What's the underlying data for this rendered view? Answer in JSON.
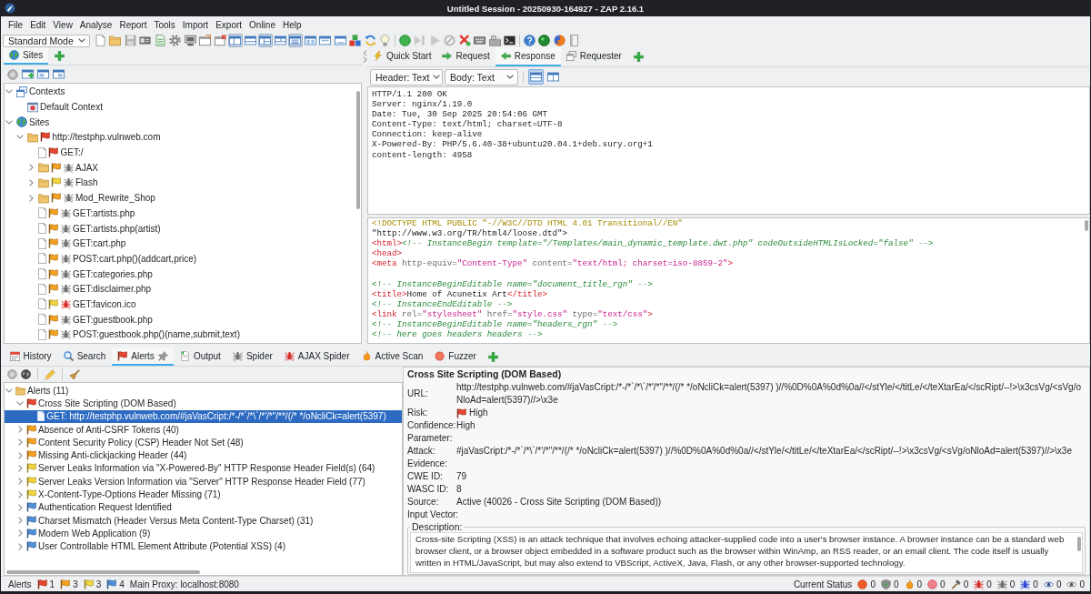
{
  "window": {
    "title": "Untitled Session - 20250930-164927 - ZAP 2.16.1"
  },
  "menu": [
    "File",
    "Edit",
    "View",
    "Analyse",
    "Report",
    "Tools",
    "Import",
    "Export",
    "Online",
    "Help"
  ],
  "toolbar": {
    "mode": "Standard Mode",
    "layout_toggles": [
      {
        "pressed": true
      },
      {
        "pressed": false
      },
      {
        "pressed": true
      },
      {
        "pressed": false
      },
      {
        "pressed": true
      },
      {
        "pressed": false
      },
      {
        "pressed": false
      },
      {
        "pressed": false
      }
    ]
  },
  "sites_panel": {
    "tabs": [
      {
        "label": "Sites",
        "selected": true
      }
    ],
    "tree": [
      {
        "label": "Contexts",
        "kind": "contexts",
        "expanded": true,
        "children": [
          {
            "label": "Default Context",
            "kind": "context"
          }
        ]
      },
      {
        "label": "Sites",
        "kind": "sites",
        "expanded": true,
        "children": [
          {
            "label": "http://testphp.vulnweb.com",
            "kind": "folder",
            "flag": {
              "color": "#e9462f"
            },
            "expanded": true,
            "children": [
              {
                "label": "GET:/",
                "kind": "page",
                "flag": {
                  "color": "#e9462f"
                }
              },
              {
                "label": "AJAX",
                "kind": "folder",
                "flag": {
                  "color": "#f6a21f"
                },
                "spider": {
                  "color": "#6f6f6f"
                },
                "expanded": false
              },
              {
                "label": "Flash",
                "kind": "folder",
                "flag": {
                  "color": "#f3d43a"
                },
                "spider": {
                  "color": "#6f6f6f"
                },
                "expanded": false
              },
              {
                "label": "Mod_Rewrite_Shop",
                "kind": "folder",
                "flag": {
                  "color": "#f6a21f"
                },
                "spider": {
                  "color": "#6f6f6f"
                },
                "expanded": false
              },
              {
                "label": "GET:artists.php",
                "kind": "page",
                "flag": {
                  "color": "#f6a21f"
                },
                "spider": {
                  "color": "#6f6f6f"
                }
              },
              {
                "label": "GET:artists.php(artist)",
                "kind": "page",
                "flag": {
                  "color": "#f6a21f"
                },
                "spider": {
                  "color": "#6f6f6f"
                }
              },
              {
                "label": "GET:cart.php",
                "kind": "page",
                "flag": {
                  "color": "#f6a21f"
                },
                "spider": {
                  "color": "#6f6f6f"
                }
              },
              {
                "label": "POST:cart.php()(addcart,price)",
                "kind": "page",
                "flag": {
                  "color": "#f6a21f"
                },
                "spider": {
                  "color": "#6f6f6f"
                }
              },
              {
                "label": "GET:categories.php",
                "kind": "page",
                "flag": {
                  "color": "#f6a21f"
                },
                "spider": {
                  "color": "#6f6f6f"
                }
              },
              {
                "label": "GET:disclaimer.php",
                "kind": "page",
                "flag": {
                  "color": "#f6a21f"
                },
                "spider": {
                  "color": "#6f6f6f"
                }
              },
              {
                "label": "GET:favicon.ico",
                "kind": "page",
                "flag": {
                  "color": "#f3d43a"
                },
                "spider": {
                  "color": "#d62a2a"
                }
              },
              {
                "label": "GET:guestbook.php",
                "kind": "page",
                "flag": {
                  "color": "#f6a21f"
                },
                "spider": {
                  "color": "#6f6f6f"
                }
              },
              {
                "label": "POST:guestbook.php()(name,submit,text)",
                "kind": "page",
                "flag": {
                  "color": "#f6a21f"
                },
                "spider": {
                  "color": "#6f6f6f"
                }
              }
            ]
          }
        ]
      }
    ]
  },
  "request_panel": {
    "tabs": [
      {
        "label": "Quick Start",
        "selected": false
      },
      {
        "label": "Request",
        "selected": false
      },
      {
        "label": "Response",
        "selected": true
      },
      {
        "label": "Requester",
        "selected": false
      }
    ],
    "header_view": "Header: Text",
    "body_view": "Body: Text",
    "layout_toggles": [
      {
        "pressed": true
      },
      {
        "pressed": false
      }
    ],
    "header_lines": [
      "HTTP/1.1 200 OK",
      "Server: nginx/1.19.0",
      "Date: Tue, 30 Sep 2025 20:54:06 GMT",
      "Content-Type: text/html; charset=UTF-8",
      "Connection: keep-alive",
      "X-Powered-By: PHP/5.6.40-38+ubuntu20.04.1+deb.sury.org+1",
      "content-length: 4958"
    ],
    "body_blocks": [
      {
        "lines": [
          {
            "tokens": [
              {
                "kind": "doctype",
                "text": "<!DOCTYPE HTML PUBLIC \"-//W3C//DTD HTML 4.01 Transitional//EN\""
              }
            ]
          },
          {
            "tokens": [
              {
                "kind": "text",
                "text": "\"http://www.w3.org/TR/html4/loose.dtd\">"
              }
            ]
          },
          {
            "tokens": [
              {
                "kind": "tag",
                "text": "<html>"
              },
              {
                "kind": "comment",
                "text": "<!-- InstanceBegin template=\"/Templates/main_dynamic_template.dwt.php\" codeOutsideHTMLIsLocked=\"false\" -->"
              }
            ]
          },
          {
            "tokens": [
              {
                "kind": "tag",
                "text": "<head>"
              }
            ]
          },
          {
            "tokens": [
              {
                "kind": "tag",
                "text": "<meta"
              },
              {
                "kind": "attr",
                "text": " http-equiv="
              },
              {
                "kind": "value",
                "text": "\"Content-Type\""
              },
              {
                "kind": "attr",
                "text": " content="
              },
              {
                "kind": "value",
                "text": "\"text/html; charset=iso-8859-2\""
              },
              {
                "kind": "tag",
                "text": ">"
              }
            ]
          }
        ]
      },
      {
        "lines": [
          {
            "tokens": [
              {
                "kind": "comment",
                "text": "<!-- InstanceBeginEditable name=\"document_title_rgn\" -->"
              }
            ]
          },
          {
            "tokens": [
              {
                "kind": "tag",
                "text": "<title>"
              },
              {
                "kind": "text",
                "text": "Home of Acunetix Art"
              },
              {
                "kind": "tag",
                "text": "</title>"
              }
            ]
          },
          {
            "tokens": [
              {
                "kind": "comment",
                "text": "<!-- InstanceEndEditable -->"
              }
            ]
          },
          {
            "tokens": [
              {
                "kind": "tag",
                "text": "<link"
              },
              {
                "kind": "attr",
                "text": " rel="
              },
              {
                "kind": "value",
                "text": "\"stylesheet\""
              },
              {
                "kind": "attr",
                "text": " href="
              },
              {
                "kind": "value",
                "text": "\"style.css\""
              },
              {
                "kind": "attr",
                "text": " type="
              },
              {
                "kind": "value",
                "text": "\"text/css\""
              },
              {
                "kind": "tag",
                "text": ">"
              }
            ]
          },
          {
            "tokens": [
              {
                "kind": "comment",
                "text": "<!-- InstanceBeginEditable name=\"headers_rgn\" -->"
              }
            ]
          },
          {
            "tokens": [
              {
                "kind": "comment",
                "text": "<!-- here goes headers headers -->"
              }
            ]
          }
        ]
      }
    ]
  },
  "bottom_panel": {
    "tabs": [
      {
        "label": "History",
        "selected": false,
        "pinned": false
      },
      {
        "label": "Search",
        "selected": false,
        "pinned": false
      },
      {
        "label": "Alerts",
        "selected": true,
        "pinned": true
      },
      {
        "label": "Output",
        "selected": false,
        "pinned": false
      },
      {
        "label": "Spider",
        "selected": false,
        "pinned": false
      },
      {
        "label": "AJAX Spider",
        "selected": false,
        "pinned": false
      },
      {
        "label": "Active Scan",
        "selected": false,
        "pinned": false
      },
      {
        "label": "Fuzzer",
        "selected": false,
        "pinned": false
      }
    ],
    "alerts_tree": [
      {
        "label": "Alerts (11)",
        "kind": "folder",
        "expanded": true,
        "selected": false,
        "children": [
          {
            "label": "Cross Site Scripting (DOM Based)",
            "flag": {
              "color": "#e9462f"
            },
            "expanded": true,
            "selected": false,
            "children": [
              {
                "label": "GET: http://testphp.vulnweb.com/#jaVasCript:/*-/*`/*\\`/*'/*\"/**/(/* */oNcliCk=alert(5397)",
                "kind": "page",
                "selected": true
              }
            ]
          },
          {
            "label": "Absence of Anti-CSRF Tokens (40)",
            "flag": {
              "color": "#f6a21f"
            },
            "expanded": false,
            "selected": false
          },
          {
            "label": "Content Security Policy (CSP) Header Not Set (48)",
            "flag": {
              "color": "#f6a21f"
            },
            "expanded": false,
            "selected": false
          },
          {
            "label": "Missing Anti-clickjacking Header (44)",
            "flag": {
              "color": "#f6a21f"
            },
            "expanded": false,
            "selected": false
          },
          {
            "label": "Server Leaks Information via \"X-Powered-By\" HTTP Response Header Field(s) (64)",
            "flag": {
              "color": "#f3d43a"
            },
            "expanded": false,
            "selected": false
          },
          {
            "label": "Server Leaks Version Information via \"Server\" HTTP Response Header Field (77)",
            "flag": {
              "color": "#f3d43a"
            },
            "expanded": false,
            "selected": false
          },
          {
            "label": "X-Content-Type-Options Header Missing (71)",
            "flag": {
              "color": "#f3d43a"
            },
            "expanded": false,
            "selected": false
          },
          {
            "label": "Authentication Request Identified",
            "flag": {
              "color": "#4f90dc"
            },
            "expanded": false,
            "selected": false
          },
          {
            "label": "Charset Mismatch (Header Versus Meta Content-Type Charset) (31)",
            "flag": {
              "color": "#4f90dc"
            },
            "expanded": false,
            "selected": false
          },
          {
            "label": "Modern Web Application (9)",
            "flag": {
              "color": "#4f90dc"
            },
            "expanded": false,
            "selected": false
          },
          {
            "label": "User Controllable HTML Element Attribute (Potential XSS) (4)",
            "flag": {
              "color": "#4f90dc"
            },
            "expanded": false,
            "selected": false
          }
        ]
      }
    ],
    "alert_detail": {
      "title": "Cross Site Scripting (DOM Based)",
      "fields": [
        {
          "label": "URL:",
          "value": "http://testphp.vulnweb.com/#jaVasCript:/*-/*`/*\\`/*'/*\"/**/(/* */oNcliCk=alert(5397) )//%0D%0A%0d%0a//</stYle/</titLe/</teXtarEa/</scRipt/--!>\\x3csVg/<sVg/oNloAd=alert(5397)//>\\x3e"
        },
        {
          "label": "Risk:",
          "value": "High",
          "flag": {
            "color": "#e9462f"
          }
        },
        {
          "label": "Confidence:",
          "value": "High"
        },
        {
          "label": "Parameter:"
        },
        {
          "label": "Attack:",
          "value": "#jaVasCript:/*-/*`/*\\`/*'/*\"/**/(/* */oNcliCk=alert(5397) )//%0D%0A%0d%0a//</stYle/</titLe/</teXtarEa/</scRipt/--!>\\x3csVg/<sVg/oNloAd=alert(5397)//>\\x3e"
        },
        {
          "label": "Evidence:"
        },
        {
          "label": "CWE ID:",
          "value": "79"
        },
        {
          "label": "WASC ID:",
          "value": "8"
        },
        {
          "label": "Source:",
          "value": "Active (40026 - Cross Site Scripting (DOM Based))"
        },
        {
          "label": "Input Vector:"
        }
      ],
      "description_label": "Description:",
      "description": "Cross-site Scripting (XSS) is an attack technique that involves echoing attacker-supplied code into a user's browser instance. A browser instance can be a standard web browser client, or a browser object embedded in a software product such as the browser within WinAmp, an RSS reader, or an email client. The code itself is usually written in HTML/JavaScript, but may also extend to VBScript, ActiveX, Java, Flash, or any other browser-supported technology."
    }
  },
  "status_bar": {
    "alerts_label": "Alerts",
    "alert_counts": [
      {
        "color": "#e9462f",
        "count": "1"
      },
      {
        "color": "#f6a21f",
        "count": "3"
      },
      {
        "color": "#f3d43a",
        "count": "3"
      },
      {
        "color": "#4f90dc",
        "count": "4"
      }
    ],
    "proxy": "Main Proxy: localhost:8080",
    "status_label": "Current Status",
    "status_counts": [
      "0",
      "0",
      "0",
      "0",
      "0",
      "0",
      "0",
      "0",
      "0",
      "0"
    ]
  }
}
